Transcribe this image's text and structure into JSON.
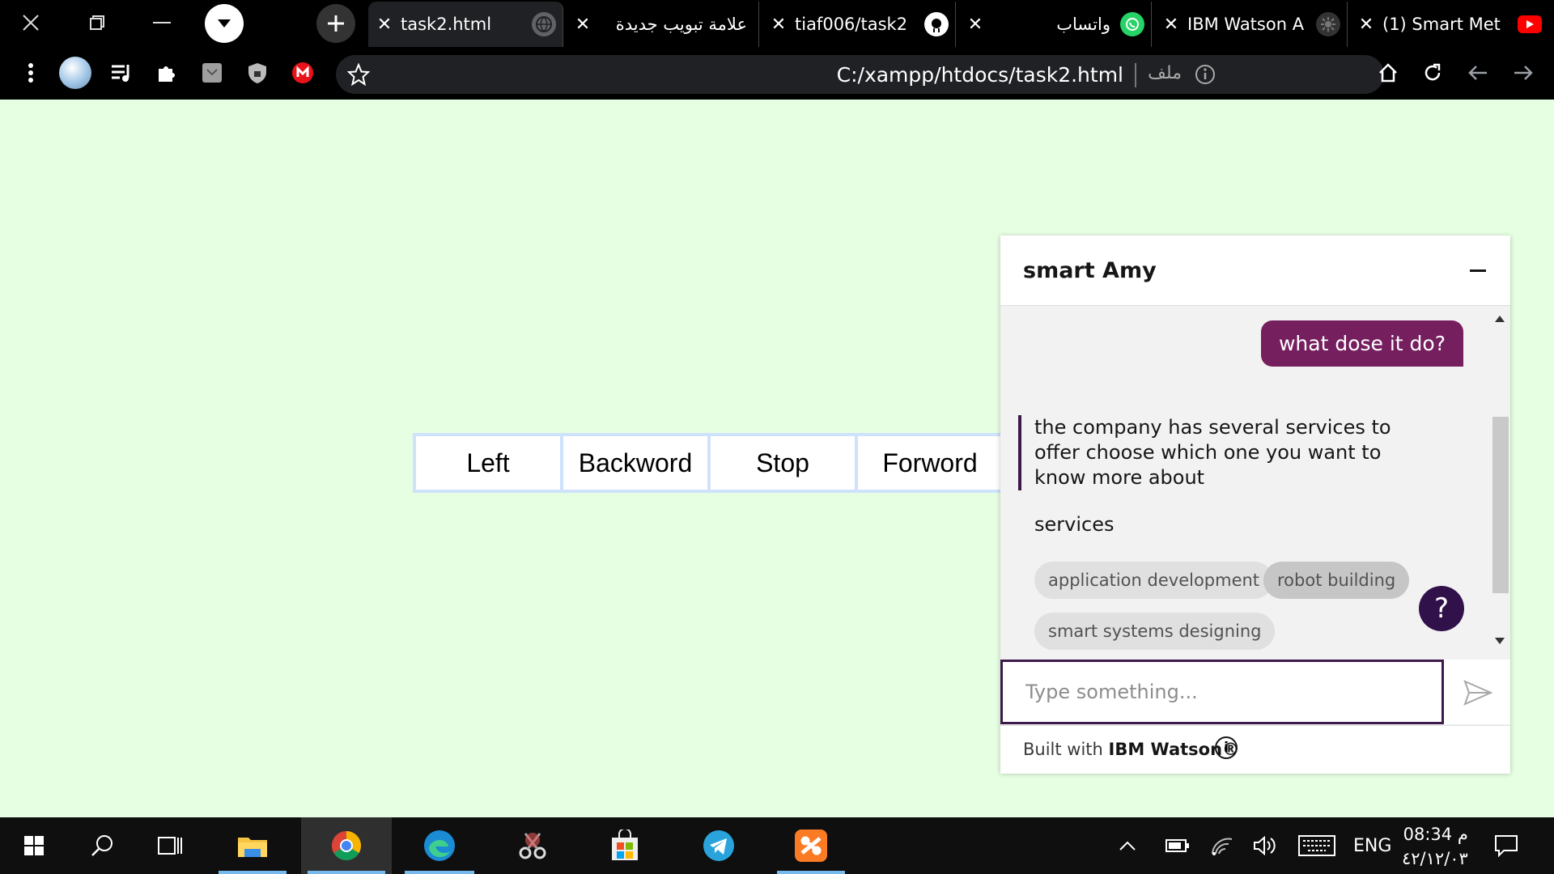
{
  "browser": {
    "tabs": [
      {
        "title": "task2.html",
        "active": true,
        "icon": "globe-icon"
      },
      {
        "title": "علامة تبويب جديدة",
        "active": false,
        "icon": ""
      },
      {
        "title": "tiaf006/task2",
        "active": false,
        "icon": "github-icon"
      },
      {
        "title": "واتساب",
        "active": false,
        "icon": "whatsapp-icon"
      },
      {
        "title": "IBM Watson A",
        "active": false,
        "icon": "watson-icon"
      },
      {
        "title": "(1) Smart Met",
        "active": false,
        "icon": "youtube-icon"
      }
    ],
    "url": "C:/xampp/htdocs/task2.html",
    "url_prefix": "ملف"
  },
  "controls": {
    "left": "Left",
    "backward": "Backword",
    "stop": "Stop",
    "forward": "Forword"
  },
  "chat": {
    "title": "smart Amy",
    "user_message": "what dose it do?",
    "bot_message": "the company has several services to offer choose which one you want to know more about",
    "services_label": "services",
    "options": [
      "application development",
      "robot building",
      "smart systems designing"
    ],
    "selected_option": "robot building",
    "help_label": "?",
    "input_placeholder": "Type something...",
    "footer_prefix": "Built with ",
    "footer_brand": "IBM Watson®",
    "footer_info": "i"
  },
  "taskbar": {
    "language": "ENG",
    "time": "08:34 م",
    "date": "٤٢/١٢/٠٣"
  },
  "colors": {
    "page_bg": "#e6ffe2",
    "user_bubble": "#751f5f",
    "accent": "#31114a",
    "button_border": "#cfe2fb"
  }
}
